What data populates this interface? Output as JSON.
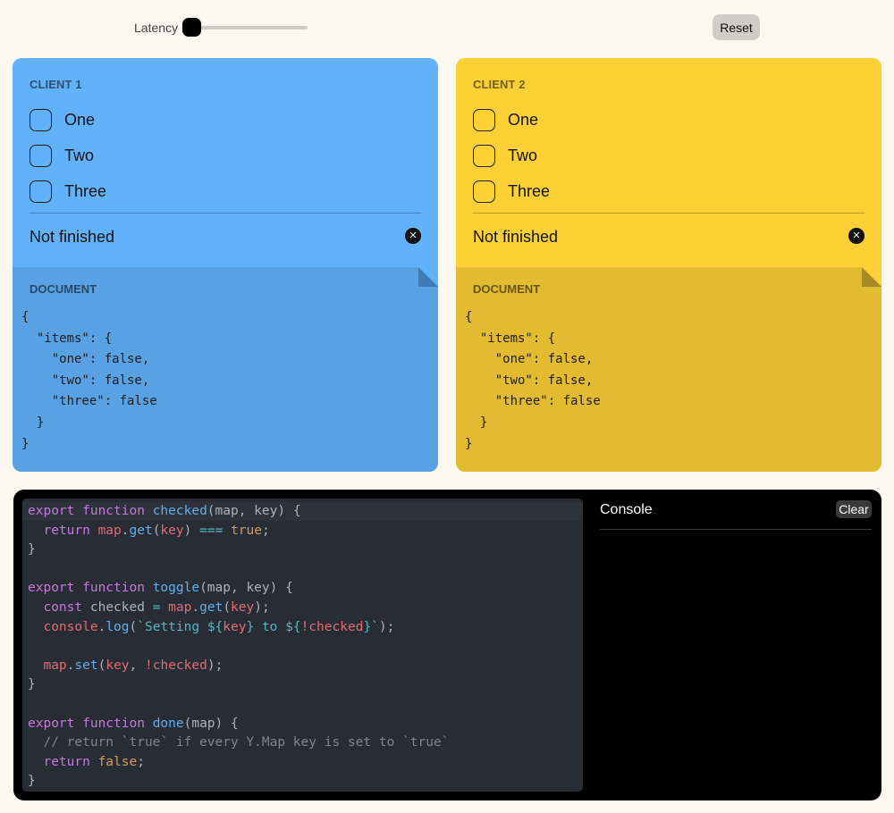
{
  "topbar": {
    "latency_label": "Latency",
    "latency_value": 0,
    "reset_label": "Reset"
  },
  "clients": [
    {
      "title": "CLIENT 1",
      "color": "#62b2fb",
      "items": [
        {
          "label": "One",
          "checked": false
        },
        {
          "label": "Two",
          "checked": false
        },
        {
          "label": "Three",
          "checked": false
        }
      ],
      "status": "Not finished",
      "status_icon": "close-circle-icon",
      "document_title": "DOCUMENT",
      "document_json": "{\n  \"items\": {\n    \"one\": false,\n    \"two\": false,\n    \"three\": false\n  }\n}"
    },
    {
      "title": "CLIENT 2",
      "color": "#fdd036",
      "items": [
        {
          "label": "One",
          "checked": false
        },
        {
          "label": "Two",
          "checked": false
        },
        {
          "label": "Three",
          "checked": false
        }
      ],
      "status": "Not finished",
      "status_icon": "close-circle-icon",
      "document_title": "DOCUMENT",
      "document_json": "{\n  \"items\": {\n    \"one\": false,\n    \"two\": false,\n    \"three\": false\n  }\n}"
    }
  ],
  "editor": {
    "lines": [
      [
        [
          "kw",
          "export "
        ],
        [
          "kw",
          "function "
        ],
        [
          "fn",
          "checked"
        ],
        [
          "plain",
          "(map, key) {"
        ]
      ],
      [
        [
          "plain",
          "  "
        ],
        [
          "kw",
          "return "
        ],
        [
          "var",
          "map"
        ],
        [
          "plain",
          "."
        ],
        [
          "fn",
          "get"
        ],
        [
          "plain",
          "("
        ],
        [
          "var",
          "key"
        ],
        [
          "plain",
          ") "
        ],
        [
          "op",
          "==="
        ],
        [
          "plain",
          " "
        ],
        [
          "bool",
          "true"
        ],
        [
          "plain",
          ";"
        ]
      ],
      [
        [
          "plain",
          "}"
        ]
      ],
      [
        [
          "plain",
          ""
        ]
      ],
      [
        [
          "kw",
          "export "
        ],
        [
          "kw",
          "function "
        ],
        [
          "fn",
          "toggle"
        ],
        [
          "plain",
          "(map, key) {"
        ]
      ],
      [
        [
          "plain",
          "  "
        ],
        [
          "kw",
          "const "
        ],
        [
          "plain",
          "checked "
        ],
        [
          "op",
          "="
        ],
        [
          "plain",
          " "
        ],
        [
          "var",
          "map"
        ],
        [
          "plain",
          "."
        ],
        [
          "fn",
          "get"
        ],
        [
          "plain",
          "("
        ],
        [
          "var",
          "key"
        ],
        [
          "plain",
          ");"
        ]
      ],
      [
        [
          "plain",
          "  "
        ],
        [
          "var",
          "console"
        ],
        [
          "plain",
          "."
        ],
        [
          "fn",
          "log"
        ],
        [
          "plain",
          "("
        ],
        [
          "tpl",
          "`Setting ${"
        ],
        [
          "var",
          "key"
        ],
        [
          "tpl",
          "} to ${"
        ],
        [
          "var",
          "!checked"
        ],
        [
          "tpl",
          "}`"
        ],
        [
          "plain",
          ");"
        ]
      ],
      [
        [
          "plain",
          ""
        ]
      ],
      [
        [
          "plain",
          "  "
        ],
        [
          "var",
          "map"
        ],
        [
          "plain",
          "."
        ],
        [
          "fn",
          "set"
        ],
        [
          "plain",
          "("
        ],
        [
          "var",
          "key"
        ],
        [
          "plain",
          ", "
        ],
        [
          "var",
          "!checked"
        ],
        [
          "plain",
          ");"
        ]
      ],
      [
        [
          "plain",
          "}"
        ]
      ],
      [
        [
          "plain",
          ""
        ]
      ],
      [
        [
          "kw",
          "export "
        ],
        [
          "kw",
          "function "
        ],
        [
          "fn",
          "done"
        ],
        [
          "plain",
          "(map) {"
        ]
      ],
      [
        [
          "cm",
          "  // return `true` if every Y.Map key is set to `true`"
        ]
      ],
      [
        [
          "plain",
          "  "
        ],
        [
          "kw",
          "return "
        ],
        [
          "bool",
          "false"
        ],
        [
          "plain",
          ";"
        ]
      ],
      [
        [
          "plain",
          "}"
        ]
      ]
    ]
  },
  "console": {
    "title": "Console",
    "clear_label": "Clear"
  }
}
